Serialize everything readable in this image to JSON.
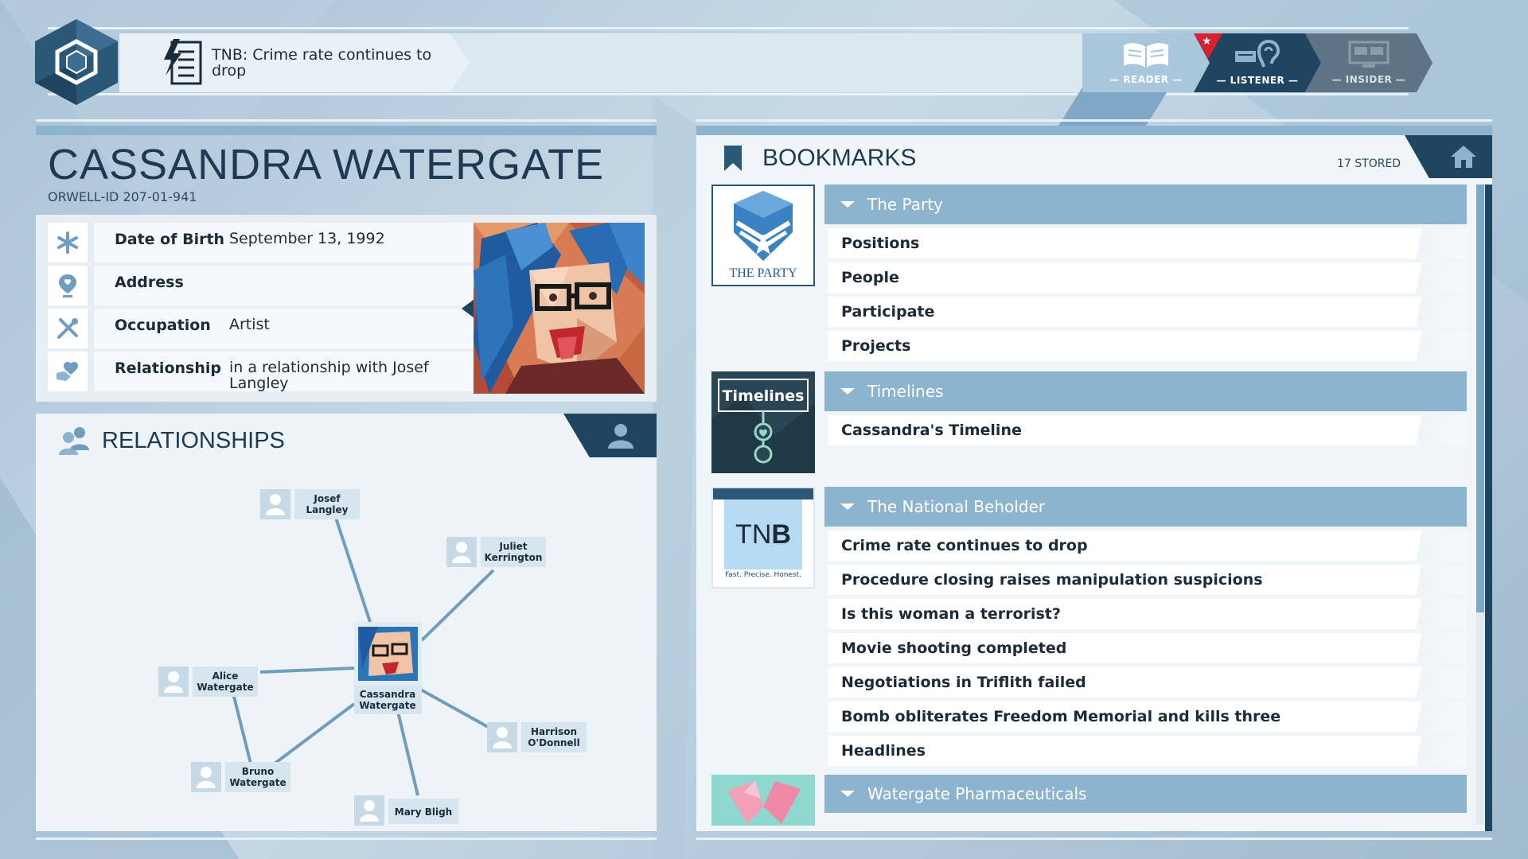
{
  "news": {
    "headline": "TNB: Crime rate continues to drop"
  },
  "modes": [
    {
      "label": "— READER —"
    },
    {
      "label": "— LISTENER —"
    },
    {
      "label": "— INSIDER —"
    }
  ],
  "profile": {
    "name": "CASSANDRA WATERGATE",
    "orwell_id": "ORWELL-ID  207-01-941",
    "fields": [
      {
        "icon": "asterisk-icon",
        "label": "Date of Birth",
        "value": "September 13, 1992"
      },
      {
        "icon": "location-pin-icon",
        "label": "Address",
        "value": ""
      },
      {
        "icon": "tools-icon",
        "label": "Occupation",
        "value": "Artist"
      },
      {
        "icon": "heart-hand-icon",
        "label": "Relationship",
        "value": "in a relationship with Josef Langley"
      }
    ]
  },
  "relationships": {
    "title": "RELATIONSHIPS",
    "center": {
      "name1": "Cassandra",
      "name2": "Watergate"
    },
    "nodes": [
      {
        "name1": "Josef",
        "name2": "Langley"
      },
      {
        "name1": "Juliet",
        "name2": "Kerrington"
      },
      {
        "name1": "Alice",
        "name2": "Watergate"
      },
      {
        "name1": "Harrison",
        "name2": "O'Donnell"
      },
      {
        "name1": "Bruno",
        "name2": "Watergate"
      },
      {
        "name1": "Mary Bligh",
        "name2": ""
      }
    ]
  },
  "bookmarks": {
    "title": "BOOKMARKS",
    "stored": "17 STORED",
    "thumbs": {
      "party": "THE PARTY",
      "timelines": "Timelines",
      "tnb_logo_a": "TN",
      "tnb_logo_b": "B",
      "tnb_tagline": "Fast. Precise. Honest."
    },
    "groups": [
      {
        "title": "The Party",
        "entries": [
          "Positions",
          "People",
          "Participate",
          "Projects"
        ]
      },
      {
        "title": "Timelines",
        "entries": [
          "Cassandra's Timeline"
        ]
      },
      {
        "title": "The National Beholder",
        "entries": [
          "Crime rate continues to drop",
          "Procedure closing raises manipulation suspicions",
          "Is this woman a terrorist?",
          "Movie shooting completed",
          "Negotiations in Triflith failed",
          "Bomb obliterates Freedom Memorial and kills three",
          "Headlines"
        ]
      },
      {
        "title": "Watergate Pharmaceuticals",
        "entries": []
      }
    ]
  },
  "colors": {
    "dark_navy": "#1f4560",
    "accent_blue": "#8db4cf",
    "alert_red": "#d9202e"
  }
}
